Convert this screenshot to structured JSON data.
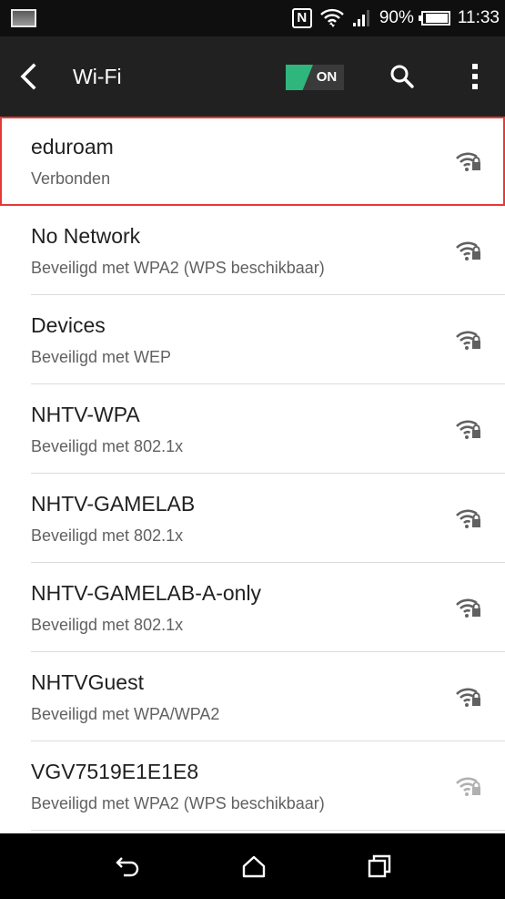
{
  "status_bar": {
    "battery_percent": "90%",
    "time": "11:33",
    "battery_level": 0.9,
    "icons": [
      "image-thumbnail-icon",
      "nfc-icon",
      "wifi-data-icon",
      "cell-signal-icon",
      "battery-icon"
    ]
  },
  "app_bar": {
    "title": "Wi-Fi",
    "toggle_label": "ON",
    "toggle_color": "#2fb67c",
    "icons": [
      "back-arrow-icon",
      "search-icon",
      "more-vert-icon"
    ]
  },
  "networks": [
    {
      "name": "eduroam",
      "status": "Verbonden",
      "selected": true,
      "signal": "strong"
    },
    {
      "name": "No Network",
      "status": "Beveiligd met WPA2 (WPS beschikbaar)",
      "selected": false,
      "signal": "strong"
    },
    {
      "name": "Devices",
      "status": "Beveiligd met WEP",
      "selected": false,
      "signal": "strong"
    },
    {
      "name": "NHTV-WPA",
      "status": "Beveiligd met 802.1x",
      "selected": false,
      "signal": "strong"
    },
    {
      "name": "NHTV-GAMELAB",
      "status": "Beveiligd met 802.1x",
      "selected": false,
      "signal": "strong"
    },
    {
      "name": "NHTV-GAMELAB-A-only",
      "status": "Beveiligd met 802.1x",
      "selected": false,
      "signal": "strong"
    },
    {
      "name": "NHTVGuest",
      "status": "Beveiligd met WPA/WPA2",
      "selected": false,
      "signal": "strong"
    },
    {
      "name": "VGV7519E1E1E8",
      "status": "Beveiligd met WPA2 (WPS beschikbaar)",
      "selected": false,
      "signal": "weak"
    }
  ],
  "colors": {
    "selected_border": "#e53935",
    "app_bar_bg": "#212121",
    "wifi_icon": "#616161",
    "wifi_icon_weak": "#b0b0b0"
  },
  "nav_bar": {
    "icons": [
      "back-icon",
      "home-icon",
      "recents-icon"
    ]
  }
}
